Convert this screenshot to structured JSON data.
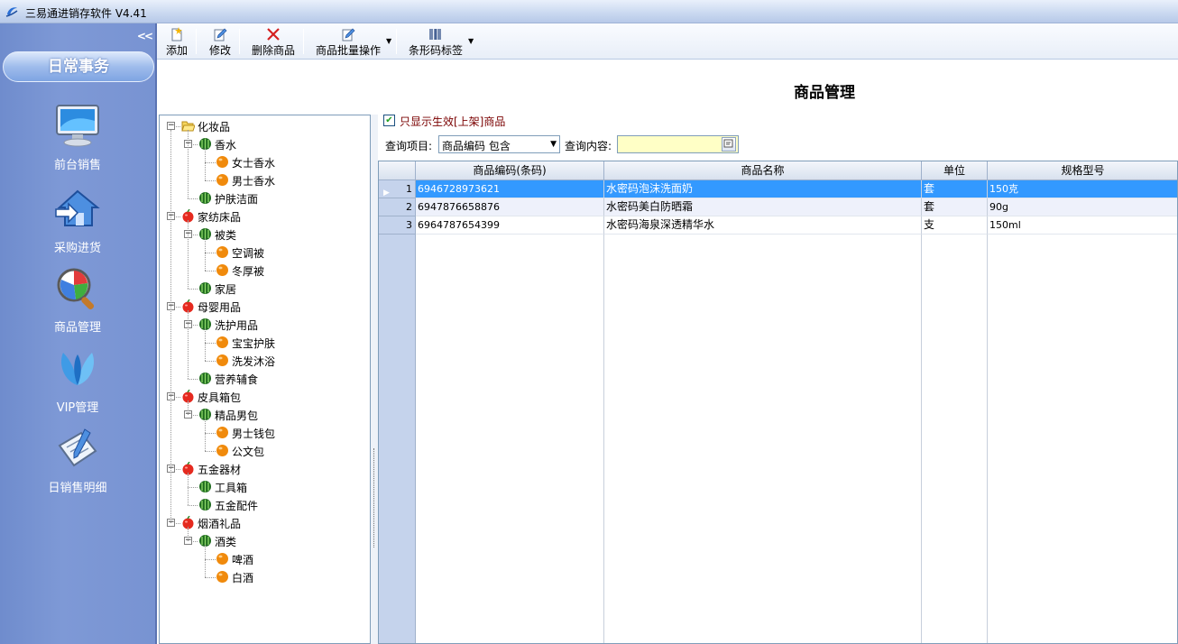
{
  "app": {
    "title": "三易通进销存软件 V4.41"
  },
  "nav": {
    "collapse": "<<",
    "header": "日常事务",
    "items": [
      {
        "label": "前台销售",
        "icon": "monitor-icon"
      },
      {
        "label": "采购进货",
        "icon": "house-arrow-icon"
      },
      {
        "label": "商品管理",
        "icon": "magnifier-chart-icon"
      },
      {
        "label": "VIP管理",
        "icon": "butterfly-icon"
      },
      {
        "label": "日销售明细",
        "icon": "document-pen-icon"
      }
    ]
  },
  "toolbar": {
    "add": "添加",
    "edit": "修改",
    "delete": "删除商品",
    "batch": "商品批量操作",
    "barcode": "条形码标签"
  },
  "page": {
    "title": "商品管理"
  },
  "tree": [
    {
      "label": "化妆品",
      "level": 0,
      "icon": "folder"
    },
    {
      "label": "香水",
      "level": 1,
      "icon": "green"
    },
    {
      "label": "女士香水",
      "level": 2,
      "icon": "orange"
    },
    {
      "label": "男士香水",
      "level": 2,
      "icon": "orange"
    },
    {
      "label": "护肤洁面",
      "level": 1,
      "icon": "green"
    },
    {
      "label": "家纺床品",
      "level": 0,
      "icon": "red"
    },
    {
      "label": "被类",
      "level": 1,
      "icon": "green"
    },
    {
      "label": "空调被",
      "level": 2,
      "icon": "orange"
    },
    {
      "label": "冬厚被",
      "level": 2,
      "icon": "orange"
    },
    {
      "label": "家居",
      "level": 1,
      "icon": "green"
    },
    {
      "label": "母婴用品",
      "level": 0,
      "icon": "red"
    },
    {
      "label": "洗护用品",
      "level": 1,
      "icon": "green"
    },
    {
      "label": "宝宝护肤",
      "level": 2,
      "icon": "orange"
    },
    {
      "label": "洗发沐浴",
      "level": 2,
      "icon": "orange"
    },
    {
      "label": "营养辅食",
      "level": 1,
      "icon": "green"
    },
    {
      "label": "皮具箱包",
      "level": 0,
      "icon": "red"
    },
    {
      "label": "精品男包",
      "level": 1,
      "icon": "green"
    },
    {
      "label": "男士钱包",
      "level": 2,
      "icon": "orange"
    },
    {
      "label": "公文包",
      "level": 2,
      "icon": "orange"
    },
    {
      "label": "五金器材",
      "level": 0,
      "icon": "red"
    },
    {
      "label": "工具箱",
      "level": 1,
      "icon": "green"
    },
    {
      "label": "五金配件",
      "level": 1,
      "icon": "green"
    },
    {
      "label": "烟酒礼品",
      "level": 0,
      "icon": "red"
    },
    {
      "label": "酒类",
      "level": 1,
      "icon": "green"
    },
    {
      "label": "啤酒",
      "level": 2,
      "icon": "orange"
    },
    {
      "label": "白酒",
      "level": 2,
      "icon": "orange"
    }
  ],
  "filter": {
    "only_active_label": "只显示生效[上架]商品",
    "only_active_checked": true,
    "query_item_label": "查询项目:",
    "query_item_value": "商品编码 包含",
    "query_content_label": "查询内容:",
    "query_content_value": ""
  },
  "grid": {
    "columns": [
      "商品编码(条码)",
      "商品名称",
      "单位",
      "规格型号"
    ],
    "rows": [
      {
        "no": "1",
        "code": "6946728973621",
        "name": "水密码泡沫洗面奶",
        "unit": "套",
        "spec": "150克",
        "selected": true
      },
      {
        "no": "2",
        "code": "6947876658876",
        "name": "水密码美白防晒霜",
        "unit": "套",
        "spec": "90g",
        "selected": false
      },
      {
        "no": "3",
        "code": "6964787654399",
        "name": "水密码海泉深透精华水",
        "unit": "支",
        "spec": "150ml",
        "selected": false
      }
    ]
  },
  "colors": {
    "nav_bg": "#7893d2",
    "selected_row": "#3399ff",
    "input_bg": "#ffffc6",
    "checkbox_label": "#7a0000"
  }
}
